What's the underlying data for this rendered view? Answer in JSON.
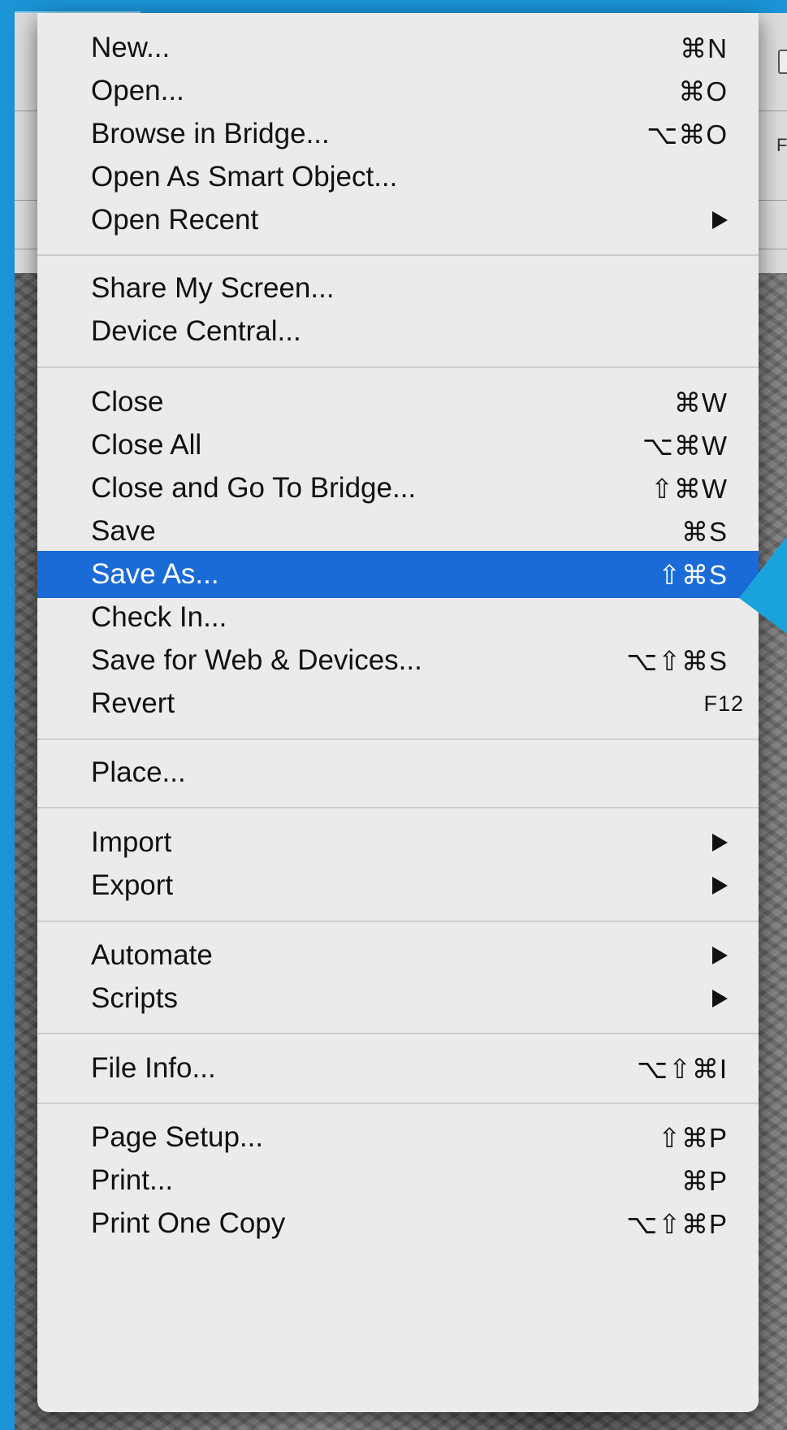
{
  "colors": {
    "frame": "#1a94d6",
    "menu_bg": "#ebebeb",
    "highlight": "#1a6bd6",
    "annotation": "#19a3dc"
  },
  "background": {
    "side_text": "Flo"
  },
  "menu": {
    "items": [
      {
        "label": "New...",
        "shortcut": "⌘N"
      },
      {
        "label": "Open...",
        "shortcut": "⌘O"
      },
      {
        "label": "Browse in Bridge...",
        "shortcut": "⌥⌘O"
      },
      {
        "label": "Open As Smart Object...",
        "shortcut": ""
      },
      {
        "label": "Open Recent",
        "shortcut": "",
        "submenu": true
      },
      {
        "label": "Share My Screen...",
        "shortcut": ""
      },
      {
        "label": "Device Central...",
        "shortcut": ""
      },
      {
        "label": "Close",
        "shortcut": "⌘W"
      },
      {
        "label": "Close All",
        "shortcut": "⌥⌘W"
      },
      {
        "label": "Close and Go To Bridge...",
        "shortcut": "⇧⌘W"
      },
      {
        "label": "Save",
        "shortcut": "⌘S"
      },
      {
        "label": "Save As...",
        "shortcut": "⇧⌘S",
        "highlighted": true
      },
      {
        "label": "Check In...",
        "shortcut": ""
      },
      {
        "label": "Save for Web & Devices...",
        "shortcut": "⌥⇧⌘S"
      },
      {
        "label": "Revert",
        "shortcut": "F12"
      },
      {
        "label": "Place...",
        "shortcut": ""
      },
      {
        "label": "Import",
        "shortcut": "",
        "submenu": true
      },
      {
        "label": "Export",
        "shortcut": "",
        "submenu": true
      },
      {
        "label": "Automate",
        "shortcut": "",
        "submenu": true
      },
      {
        "label": "Scripts",
        "shortcut": "",
        "submenu": true
      },
      {
        "label": "File Info...",
        "shortcut": "⌥⇧⌘I"
      },
      {
        "label": "Page Setup...",
        "shortcut": "⇧⌘P"
      },
      {
        "label": "Print...",
        "shortcut": "⌘P"
      },
      {
        "label": "Print One Copy",
        "shortcut": "⌥⇧⌘P"
      }
    ]
  }
}
